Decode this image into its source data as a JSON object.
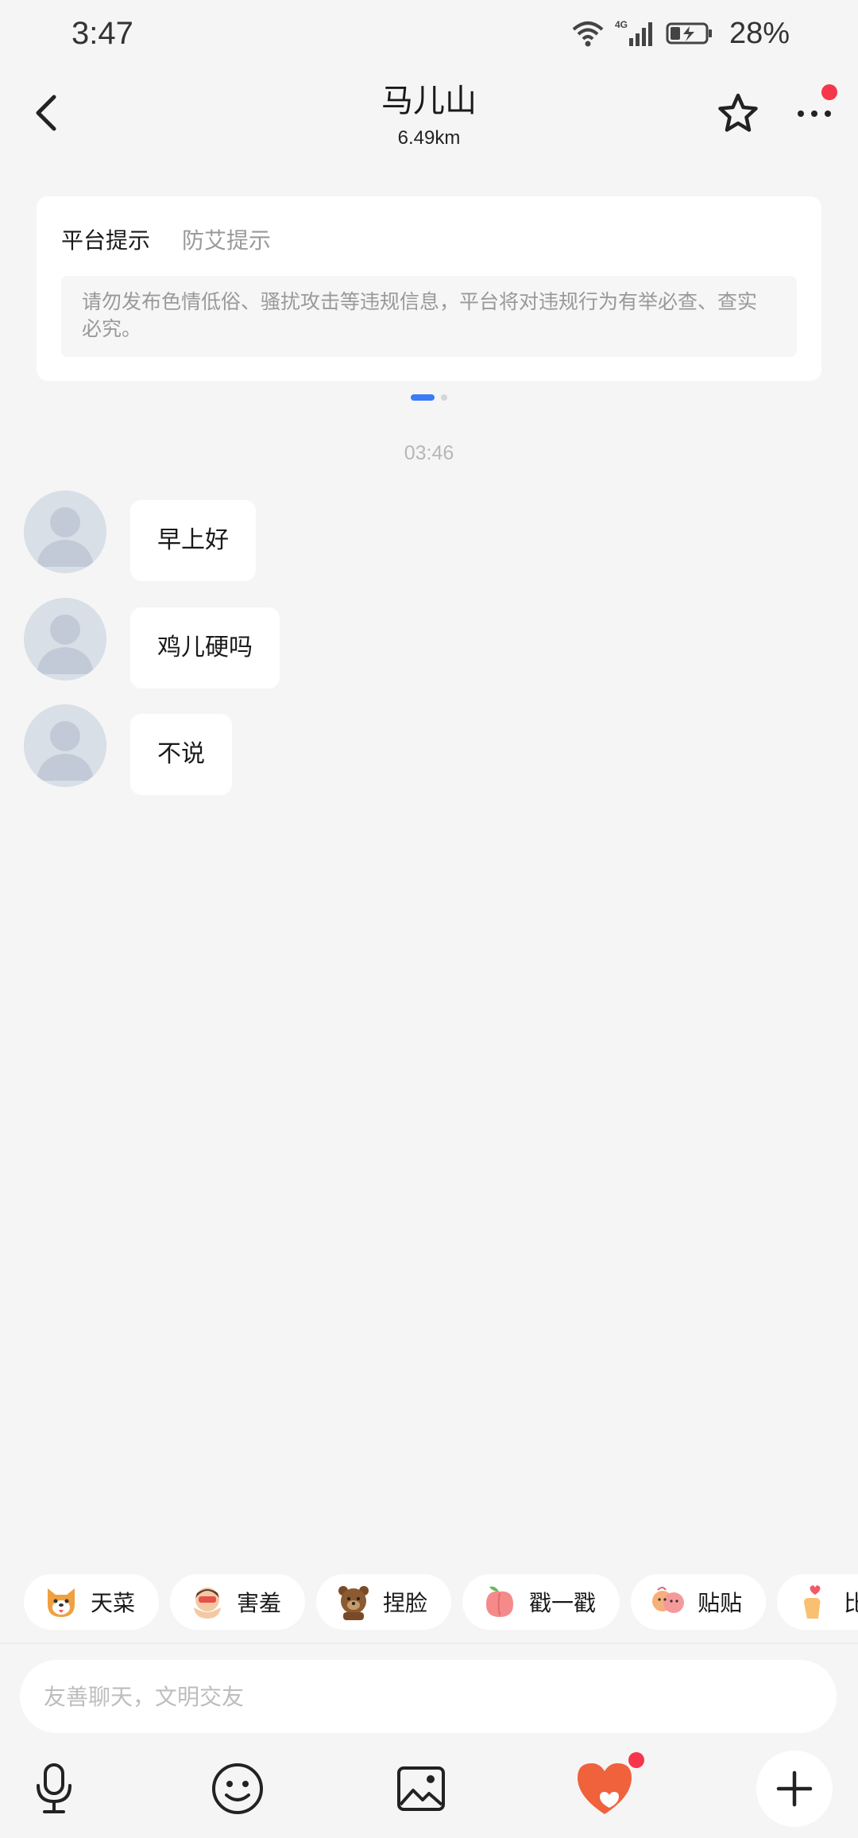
{
  "status_bar": {
    "time": "3:47",
    "network": "4G",
    "battery_percent": "28%"
  },
  "header": {
    "title": "马儿山",
    "distance": "6.49km"
  },
  "notice": {
    "tabs": [
      {
        "label": "平台提示",
        "active": true
      },
      {
        "label": "防艾提示",
        "active": false
      }
    ],
    "text": "请勿发布色情低俗、骚扰攻击等违规信息，平台将对违规行为有举必查、查实必究。",
    "pager": {
      "count": 2,
      "active_index": 0
    }
  },
  "chat": {
    "timestamp": "03:46",
    "messages": [
      {
        "text": "早上好"
      },
      {
        "text": "鸡儿硬吗"
      },
      {
        "text": "不说"
      }
    ]
  },
  "quick_chips": [
    {
      "label": "天菜",
      "icon": "dog-emoji-icon"
    },
    {
      "label": "害羞",
      "icon": "shy-face-emoji-icon"
    },
    {
      "label": "捏脸",
      "icon": "bear-emoji-icon"
    },
    {
      "label": "戳一戳",
      "icon": "peach-emoji-icon"
    },
    {
      "label": "贴贴",
      "icon": "hug-emoji-icon"
    },
    {
      "label": "比",
      "icon": "finger-heart-emoji-icon"
    }
  ],
  "input": {
    "placeholder": "友善聊天，文明交友",
    "value": ""
  },
  "toolbar": {
    "items": [
      "microphone-icon",
      "emoji-icon",
      "image-icon",
      "heart-gift-icon",
      "plus-icon"
    ]
  },
  "colors": {
    "background": "#f5f5f5",
    "accent_blue": "#3b7bf6",
    "badge_red": "#f5364b",
    "heart_orange": "#f0623c"
  }
}
